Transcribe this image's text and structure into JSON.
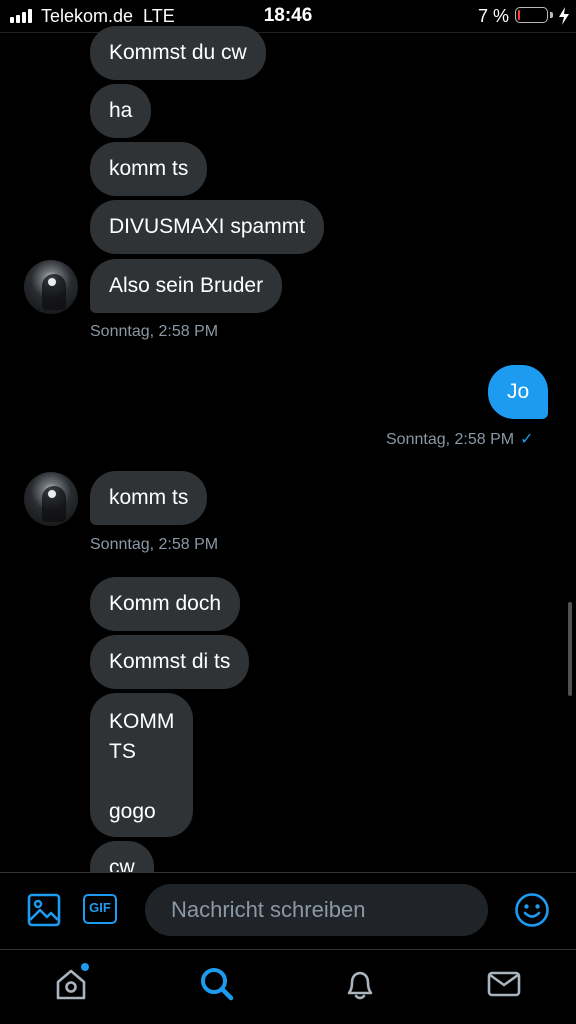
{
  "status_bar": {
    "carrier": "Telekom.de  LTE",
    "time": "18:46",
    "battery_percent": "7 %",
    "battery_level": 0.07,
    "battery_color": "#ff3b30"
  },
  "conversation": {
    "incoming_group_1": [
      "Kommst du cw",
      "ha",
      "komm ts",
      "DIVUSMAXI spammt",
      "Also sein Bruder"
    ],
    "incoming_group_1_timestamp": "Sonntag, 2:58 PM",
    "outgoing_message": "Jo",
    "outgoing_timestamp": "Sonntag, 2:58 PM",
    "incoming_group_2": [
      "komm ts"
    ],
    "incoming_group_2_timestamp": "Sonntag, 2:58 PM",
    "incoming_group_3": [
      "Komm doch",
      "Kommst di ts",
      "KOMM\nTS\n\ngogo",
      "cw"
    ]
  },
  "compose": {
    "placeholder": "Nachricht schreiben",
    "media_icon": "image-icon",
    "gif_label": "GIF",
    "emoji_icon": "smiley-icon"
  },
  "tabs": [
    {
      "name": "home",
      "icon": "home-icon",
      "has_notification": true
    },
    {
      "name": "search",
      "icon": "search-icon",
      "active": true
    },
    {
      "name": "notifications",
      "icon": "bell-icon"
    },
    {
      "name": "messages",
      "icon": "mail-icon"
    }
  ],
  "colors": {
    "accent": "#1d9bf0",
    "incoming_bubble": "#2f3336",
    "background": "#000000",
    "timestamp": "#8b98a5"
  }
}
